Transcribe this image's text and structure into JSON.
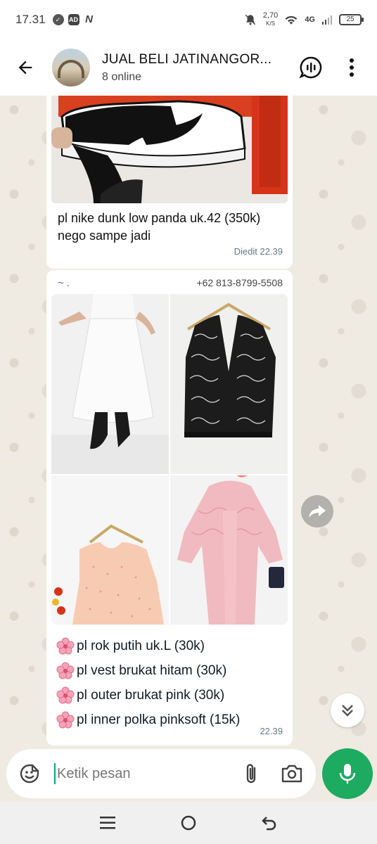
{
  "status": {
    "time": "17.31",
    "speed_value": "2,70",
    "speed_unit": "K/S",
    "network": "4G",
    "battery": "25",
    "icons": [
      "whatsapp-status-icon",
      "ad-icon",
      "n-icon",
      "mute-icon",
      "wifi-icon",
      "signal-icon",
      "battery-icon"
    ]
  },
  "header": {
    "title": "JUAL BELI JATINANGOR...",
    "subtitle": "8 online",
    "icons": [
      "back-arrow-icon",
      "group-avatar",
      "voice-chat-icon",
      "more-vert-icon"
    ]
  },
  "messages": [
    {
      "image": "sneaker-photo",
      "caption": "pl nike dunk low panda uk.42 (350k) nego sampe jadi",
      "meta": "Diedit  22.39"
    },
    {
      "sender_name": "~ .",
      "sender_phone": "+62 813-8799-5508",
      "images": [
        "white-skirt-photo",
        "black-lace-vest-photo",
        "polka-inner-photo",
        "pink-lace-outer-photo"
      ],
      "lines": [
        "pl rok putih uk.L (30k)",
        "pl vest brukat hitam (30k)",
        "pl outer brukat pink (30k)",
        "pl inner polka pinksoft (15k)"
      ],
      "meta": "22.39"
    }
  ],
  "input": {
    "placeholder": "Ketik pesan"
  },
  "colors": {
    "accent": "#1daa61",
    "chat_bg": "#efeae2",
    "bubble": "#ffffff"
  }
}
